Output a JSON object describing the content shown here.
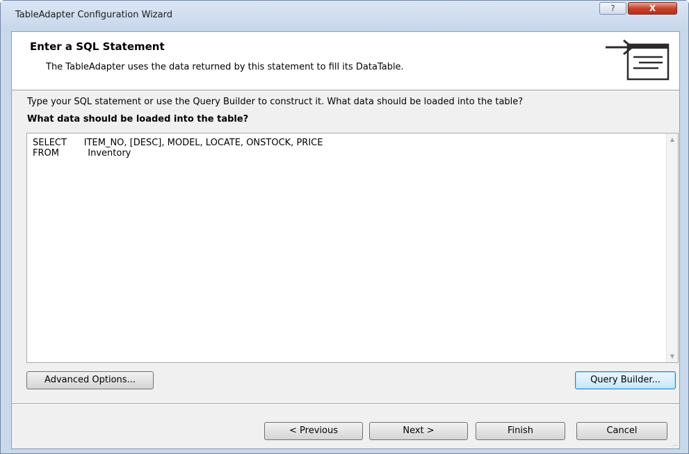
{
  "window": {
    "title": "TableAdapter Configuration Wizard",
    "help_label": "?",
    "close_label": "X"
  },
  "header": {
    "title": "Enter a SQL Statement",
    "subtitle": "The TableAdapter uses the data returned by this statement to fill its DataTable."
  },
  "main": {
    "instruction": "Type your SQL statement or use the Query Builder to construct it. What data should be loaded into the table?",
    "prompt": "What data should be loaded into the table?",
    "sql_lines": [
      "SELECT      ITEM_NO, [DESC], MODEL, LOCATE, ONSTOCK, PRICE",
      "FROM          Inventory"
    ]
  },
  "buttons": {
    "advanced": "Advanced Options...",
    "query_builder": "Query Builder...",
    "previous": "< Previous",
    "next": "Next >",
    "finish": "Finish",
    "cancel": "Cancel"
  }
}
